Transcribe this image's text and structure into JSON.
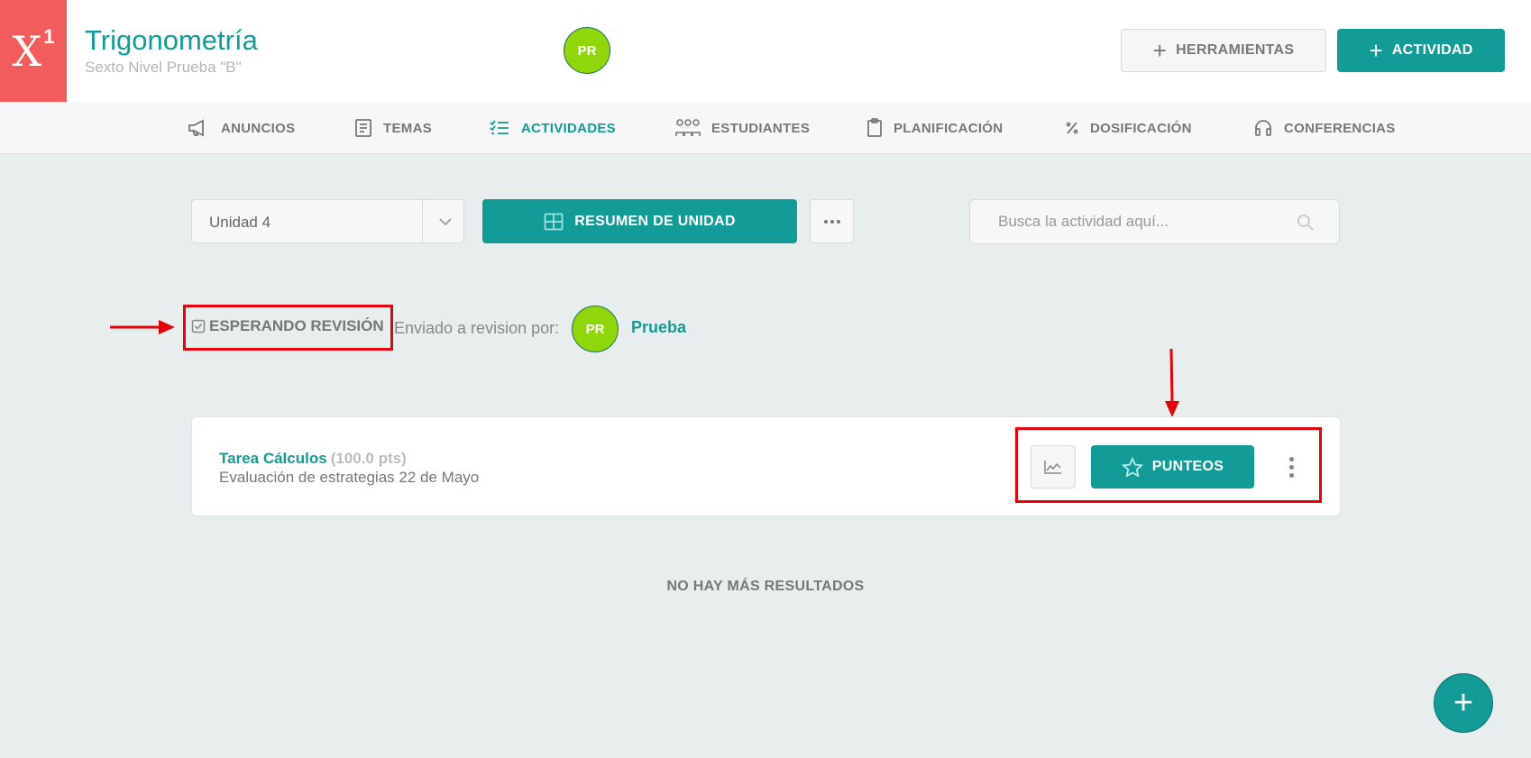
{
  "header": {
    "logo_text": "X",
    "logo_sup": "1",
    "course_title": "Trigonometría",
    "course_subtitle": "Sexto Nivel Prueba \"B\"",
    "avatar_initials": "PR",
    "tools_label": "HERRAMIENTAS",
    "activity_label": "ACTIVIDAD"
  },
  "nav": {
    "items": [
      {
        "label": "ANUNCIOS",
        "icon": "megaphone-icon"
      },
      {
        "label": "TEMAS",
        "icon": "book-icon"
      },
      {
        "label": "ACTIVIDADES",
        "icon": "checklist-icon",
        "active": true
      },
      {
        "label": "ESTUDIANTES",
        "icon": "students-icon"
      },
      {
        "label": "PLANIFICACIÓN",
        "icon": "clipboard-icon"
      },
      {
        "label": "DOSIFICACIÓN",
        "icon": "percent-icon"
      },
      {
        "label": "CONFERENCIAS",
        "icon": "headset-icon"
      }
    ]
  },
  "toolbar": {
    "unit_value": "Unidad 4",
    "summary_label": "RESUMEN DE UNIDAD",
    "search_placeholder": "Busca la actividad aquí..."
  },
  "review": {
    "status_label": "ESPERANDO REVISIÓN",
    "sent_by_text": "Enviado a revision por:",
    "avatar_initials": "PR",
    "reviewer_name": "Prueba"
  },
  "activity": {
    "title": "Tarea Cálculos",
    "points": "(100.0 pts)",
    "description": "Evaluación de estrategias 22 de Mayo",
    "punteos_label": "PUNTEOS"
  },
  "list": {
    "end_message": "NO HAY MÁS RESULTADOS"
  },
  "fab": {
    "label": "+"
  },
  "colors": {
    "accent": "#139b97",
    "logo_bg": "#f25c5c",
    "avatar_bg": "#8fd60a",
    "annotation": "#e8000b"
  }
}
